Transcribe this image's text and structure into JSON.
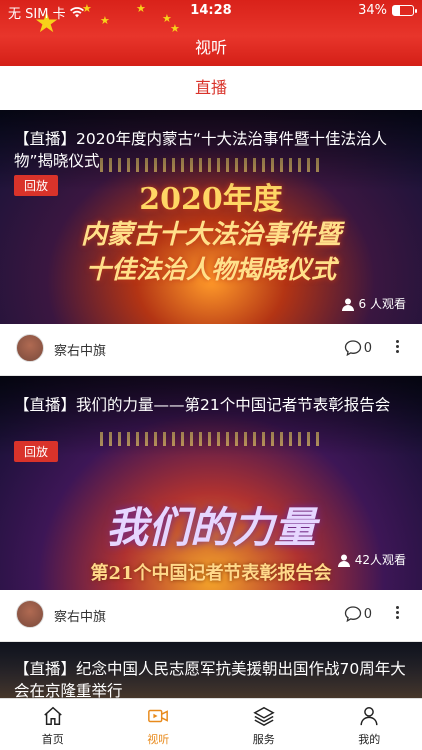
{
  "status": {
    "carrier": "无 SIM 卡",
    "time": "14:28",
    "battery": "34%",
    "battery_level": 0.34
  },
  "header": {
    "title": "视听"
  },
  "tab": {
    "label": "直播"
  },
  "feed": [
    {
      "title": "【直播】2020年度内蒙古“十大法治事件暨十佳法治人物”揭晓仪式",
      "badge": "回放",
      "thumb_text": [
        "2020年度",
        "内蒙古十大法治事件暨",
        "十佳法治人物揭晓仪式"
      ],
      "viewers": "6 人观看",
      "author": "察右中旗",
      "comments": "0"
    },
    {
      "title": "【直播】我们的力量——第21个中国记者节表彰报告会",
      "badge": "回放",
      "thumb_text": [
        "我们的力量",
        "第21个中国记者节表彰报告会"
      ],
      "viewers": "42人观看",
      "author": "察右中旗",
      "comments": "0"
    },
    {
      "title": "【直播】纪念中国人民志愿军抗美援朝出国作战70周年大会在京隆重举行"
    }
  ],
  "nav": [
    {
      "label": "首页",
      "icon": "home-icon"
    },
    {
      "label": "视听",
      "icon": "video-icon",
      "active": true
    },
    {
      "label": "服务",
      "icon": "layers-icon"
    },
    {
      "label": "我的",
      "icon": "person-icon"
    }
  ],
  "colors": {
    "accent": "#d9332a",
    "nav_active": "#e88a1c",
    "header": "#d9221a"
  }
}
